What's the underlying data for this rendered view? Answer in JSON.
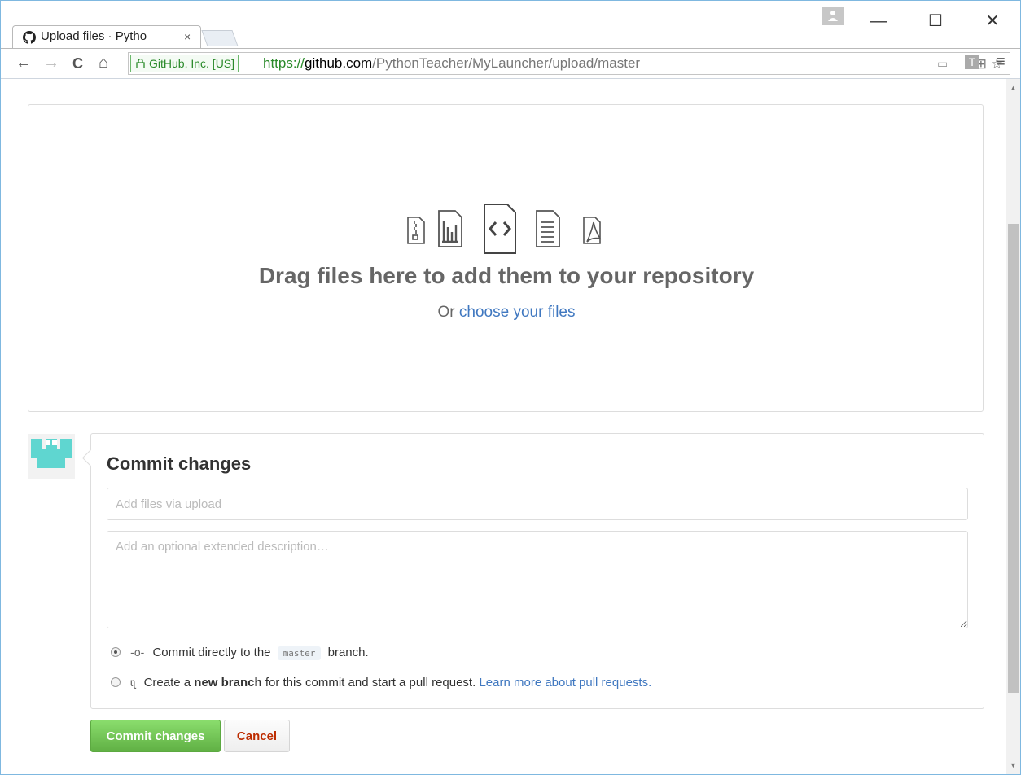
{
  "browser": {
    "tab_title": "Upload files · Pytho",
    "tab_close": "×",
    "profile_icon": "person-icon",
    "window_controls": {
      "minimize": "—",
      "maximize": "☐",
      "close": "✕"
    },
    "nav": {
      "back": "←",
      "forward": "→",
      "reload": "C",
      "home": "⌂"
    },
    "ev_cert": "GitHub, Inc. [US]",
    "url_scheme": "https://",
    "url_host": "github.com",
    "url_path": "/PythonTeacher/MyLauncher/upload/master",
    "menu": "≡"
  },
  "dropzone": {
    "title": "Drag files here to add them to your repository",
    "prefix": "Or",
    "link": "choose your files",
    "icons": [
      "file-zip-icon",
      "graph-icon",
      "code-icon",
      "text-file-icon",
      "pdf-icon"
    ]
  },
  "commit": {
    "heading": "Commit changes",
    "summary_placeholder": "Add files via upload",
    "summary_value": "",
    "description_placeholder": "Add an optional extended description…",
    "option_direct": {
      "before": "Commit directly to the",
      "branch": "master",
      "after": "branch.",
      "selected": true
    },
    "option_new_branch": {
      "before": "Create a",
      "bold": "new branch",
      "after": "for this commit and start a pull request.",
      "link": "Learn more about pull requests.",
      "selected": false
    },
    "submit_label": "Commit changes",
    "cancel_label": "Cancel"
  },
  "colors": {
    "link": "#4078c0",
    "primary_button": "#60b044",
    "cancel_text": "#bd2c00",
    "ev_green": "#2a8a2a"
  }
}
